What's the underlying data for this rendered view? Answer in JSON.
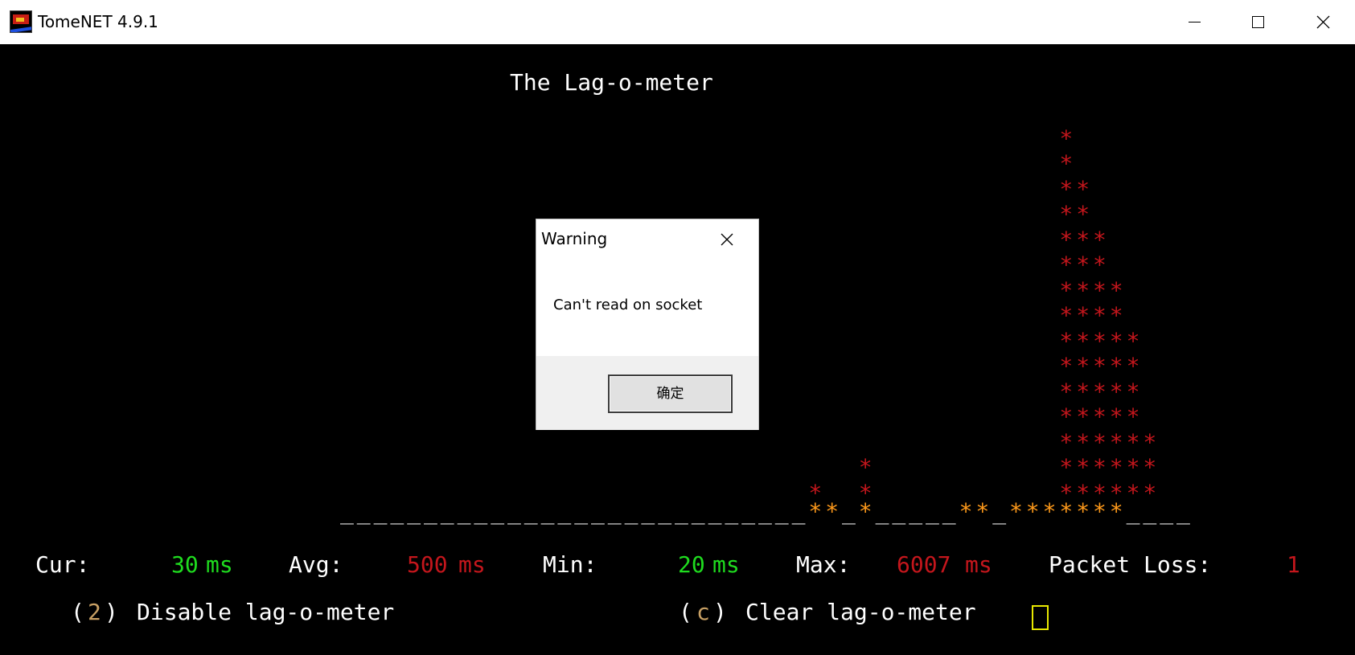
{
  "window": {
    "title": "TomeNET 4.9.1",
    "icons": [
      "tomenet-app-icon",
      "minimize-icon",
      "maximize-icon",
      "close-icon"
    ]
  },
  "screen": {
    "heading": "The Lag-o-meter",
    "stats": {
      "cur_label": "Cur:",
      "cur_value": "30",
      "avg_label": "Avg:",
      "avg_value": "500",
      "min_label": "Min:",
      "min_value": "20",
      "max_label": "Max:",
      "max_value": "6007",
      "unit": "ms",
      "loss_label": "Packet Loss:",
      "loss_value": "1"
    },
    "commands": {
      "disable_open": "(",
      "disable_key": "2",
      "disable_close": ")",
      "disable_text": "Disable lag-o-meter",
      "clear_open": "(",
      "clear_key": "c",
      "clear_close": ")",
      "clear_text": "Clear lag-o-meter"
    },
    "graph": {
      "baseline": "____________________________**_*_____**_*******____",
      "bar_heights": [
        0,
        0,
        0,
        0,
        0,
        0,
        0,
        0,
        0,
        0,
        0,
        0,
        0,
        0,
        0,
        0,
        0,
        0,
        0,
        0,
        0,
        0,
        0,
        0,
        0,
        0,
        0,
        0,
        1,
        0,
        0,
        2,
        0,
        0,
        0,
        0,
        0,
        0,
        0,
        0,
        0,
        0,
        0,
        15,
        13,
        11,
        9,
        7,
        3,
        0,
        0,
        0,
        0
      ],
      "colors": {
        "baseline": "#e0e0e0",
        "low": "#ff9a1a",
        "high": "#c4161c"
      }
    }
  },
  "dialog": {
    "title": "Warning",
    "message": "Can't read on socket",
    "ok_label": "确定"
  },
  "colors": {
    "good": "#1fdc1f",
    "bad": "#c4161c",
    "text": "#ffffff",
    "key": "#c8a064",
    "cursor": "#e8e800"
  }
}
